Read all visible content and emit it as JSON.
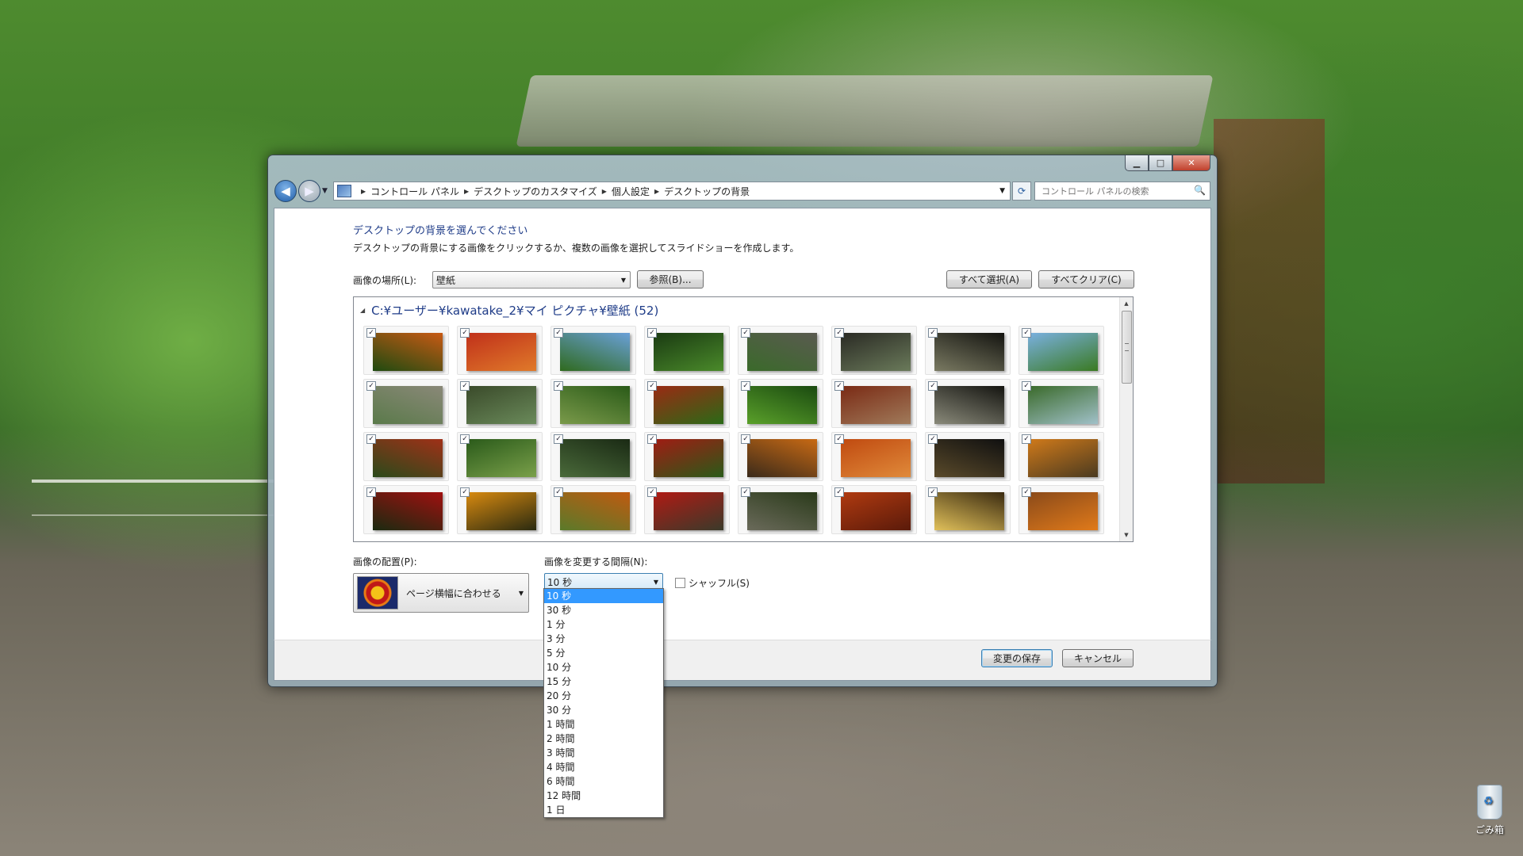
{
  "window": {
    "caption": {
      "min": "▁",
      "max": "□",
      "close": "✕"
    },
    "breadcrumb": [
      "コントロール パネル",
      "デスクトップのカスタマイズ",
      "個人設定",
      "デスクトップの背景"
    ],
    "search_placeholder": "コントロール パネルの検索"
  },
  "page": {
    "heading": "デスクトップの背景を選んでください",
    "description": "デスクトップの背景にする画像をクリックするか、複数の画像を選択してスライドショーを作成します。",
    "location_label": "画像の場所(L):",
    "location_value": "壁紙",
    "browse_button": "参照(B)...",
    "select_all_button": "すべて選択(A)",
    "clear_all_button": "すべてクリア(C)",
    "gallery_group": "C:¥ユーザー¥kawatake_2¥マイ ピクチャ¥壁紙 (52)",
    "thumbnail_colors": [
      [
        "#c85a14",
        "#1e4a10"
      ],
      [
        "#c0301a",
        "#e07a2a"
      ],
      [
        "#6aa0d8",
        "#2f6a1e"
      ],
      [
        "#1a3a12",
        "#4a8a2a"
      ],
      [
        "#5a5a50",
        "#3a6a2a"
      ],
      [
        "#2a2a24",
        "#6a7a5a"
      ],
      [
        "#141410",
        "#7a7a62"
      ],
      [
        "#7ab0e0",
        "#3a7a22"
      ],
      [
        "#8a8878",
        "#5a7a4a"
      ],
      [
        "#3a4a2a",
        "#6a8a5a"
      ],
      [
        "#2a5a18",
        "#7a9a4a"
      ],
      [
        "#9a2a14",
        "#2a6a16"
      ],
      [
        "#1a4a10",
        "#5aa02a"
      ],
      [
        "#7a2a14",
        "#a07a5a"
      ],
      [
        "#141410",
        "#8a8a7a"
      ],
      [
        "#3a6a2a",
        "#a0c0c8"
      ],
      [
        "#a03018",
        "#2a4a1a"
      ],
      [
        "#2a5a1a",
        "#7aa04a"
      ],
      [
        "#1a2a14",
        "#4a6a3a"
      ],
      [
        "#a01c14",
        "#2a5a18"
      ],
      [
        "#c86a14",
        "#3a2a1a"
      ],
      [
        "#c04a10",
        "#e08a3a"
      ],
      [
        "#101010",
        "#5a4a2a"
      ],
      [
        "#d07a1a",
        "#4a3a20"
      ],
      [
        "#a01010",
        "#1a2a10"
      ],
      [
        "#d88a10",
        "#2a2a10"
      ],
      [
        "#c05a10",
        "#5a7a2a"
      ],
      [
        "#b01a14",
        "#3a3a2a"
      ],
      [
        "#2a3a1a",
        "#6a6a5a"
      ],
      [
        "#b03a10",
        "#5a1a0a"
      ],
      [
        "#3a2a10",
        "#e0c05a"
      ],
      [
        "#8a4a1a",
        "#e07a1a"
      ]
    ],
    "position_label": "画像の配置(P):",
    "position_value": "ページ横幅に合わせる",
    "interval_label": "画像を変更する間隔(N):",
    "interval_value": "10 秒",
    "shuffle_label": "シャッフル(S)",
    "interval_options": [
      "10 秒",
      "30 秒",
      "1 分",
      "3 分",
      "5 分",
      "10 分",
      "15 分",
      "20 分",
      "30 分",
      "1 時間",
      "2 時間",
      "3 時間",
      "4 時間",
      "6 時間",
      "12 時間",
      "1 日"
    ],
    "interval_selected_index": 0,
    "save_button": "変更の保存",
    "cancel_button": "キャンセル"
  },
  "desktop": {
    "recycle_bin_label": "ごみ箱"
  }
}
